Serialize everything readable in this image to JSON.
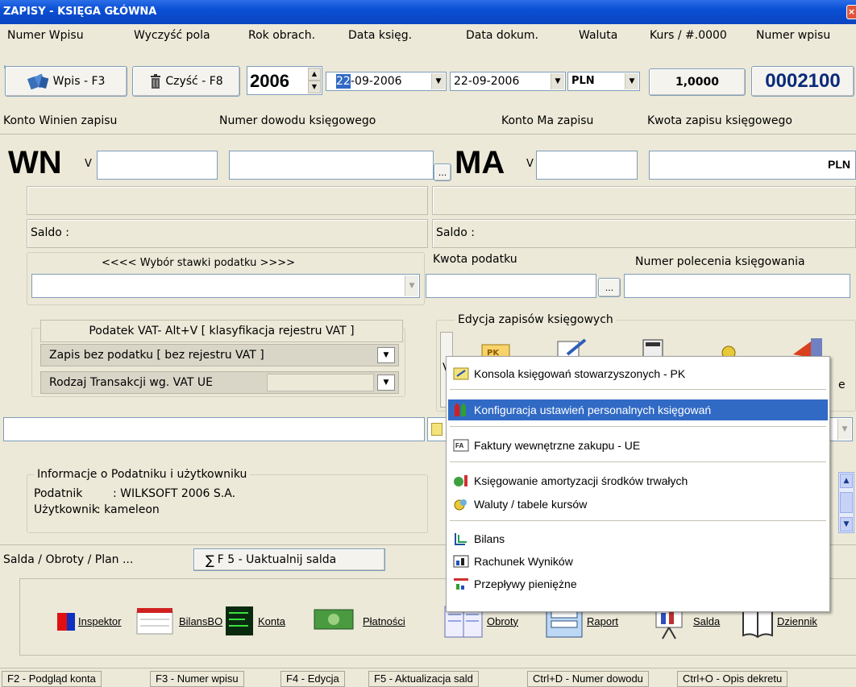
{
  "window": {
    "title": "ZAPISY - KSIĘGA GŁÓWNA",
    "close_glyph": "×"
  },
  "header_labels": {
    "numer_wpisu": "Numer Wpisu",
    "wyczysc_pola": "Wyczyść pola",
    "rok_obrach": "Rok obrach.",
    "data_ksieg": "Data księg.",
    "data_dokum": "Data dokum.",
    "waluta": "Waluta",
    "kurs": "Kurs  / #.0000",
    "numer_wpisu2": "Numer wpisu"
  },
  "toolbar": {
    "wpis_label": "Wpis - F3",
    "czysc_label": "Czyść - F8",
    "rok": "2006",
    "data_ksieg_day": "22",
    "data_ksieg_rest": "-09-2006",
    "data_dokum": "22-09-2006",
    "waluta": "PLN",
    "kurs": "1,0000",
    "numer_wpisu": "0002100"
  },
  "labels_row2": {
    "konto_winien": "Konto  Winien  zapisu",
    "numer_dowodu": "Numer dowodu księgowego",
    "konto_ma": "Konto   Ma   zapisu",
    "kwota_zapisu": "Kwota zapisu księgowego"
  },
  "entry": {
    "wn": "WN",
    "ma": "MA",
    "v": "V",
    "ellipsis": "...",
    "currency": "PLN"
  },
  "saldo": {
    "left": "Saldo :",
    "right": "Saldo :"
  },
  "tax": {
    "wybor_stawki": "<<<<  Wybór stawki podatku  >>>>",
    "kwota_podatku": "Kwota podatku",
    "numer_polecenia": "Numer polecenia księgowania"
  },
  "vat_group": {
    "title": "Podatek VAT- Alt+V [ klasyfikacja rejestru VAT ]",
    "zapis": "Zapis bez podatku [ bez rejestru VAT ]",
    "rodzaj": "Rodzaj Transakcji wg. VAT UE"
  },
  "edycja_group": {
    "title": "Edycja zapisów księgowych"
  },
  "info_group": {
    "title": "Informacje o Podatniku i użytkowniku",
    "podatnik_label": "Podatnik",
    "podatnik_value": ": WILKSOFT 2006  S.A.",
    "uzytkownik_label": "Użytkownik",
    "uzytkownik_value": ": kameleon"
  },
  "tabs": {
    "salda": "Salda / Obroty / Plan ...",
    "uaktualnij": "F 5 -  Uaktualnij salda",
    "sigma": "∑"
  },
  "tools": [
    {
      "label": "Inspektor",
      "icon": "inspector-icon"
    },
    {
      "label": "BilansBO",
      "icon": "bilansbo-icon"
    },
    {
      "label": "Konta",
      "icon": "konta-icon"
    },
    {
      "label": "Płatności",
      "icon": "platnosci-icon"
    },
    {
      "label": "Obroty",
      "icon": "obroty-icon"
    },
    {
      "label": "Raport",
      "icon": "raport-icon"
    },
    {
      "label": "Salda",
      "icon": "salda-icon"
    },
    {
      "label": "Dziennik",
      "icon": "dziennik-icon"
    }
  ],
  "menu": {
    "items": [
      {
        "label": "Konsola księgowań stowarzyszonych - PK",
        "icon": "pk-console-icon",
        "selected": false
      },
      {
        "label": "Konfiguracja ustawień personalnych księgowań",
        "icon": "config-icon",
        "selected": true
      },
      {
        "label": "Faktury wewnętrzne zakupu - UE",
        "icon": "invoice-icon",
        "selected": false
      },
      {
        "label": "Księgowanie amortyzacji środków trwałych",
        "icon": "depreciation-icon",
        "selected": false
      },
      {
        "label": "Waluty / tabele kursów",
        "icon": "currency-icon",
        "selected": false
      },
      {
        "label": "Bilans",
        "icon": "balance-icon",
        "selected": false
      },
      {
        "label": "Rachunek Wyników",
        "icon": "income-icon",
        "selected": false
      },
      {
        "label": "Przepływy pieniężne",
        "icon": "cashflow-icon",
        "selected": false
      }
    ]
  },
  "partial": {
    "lett_v": "V",
    "lett_e": "e",
    "pk_text": "PK"
  },
  "statusbar": [
    "F2 - Podgląd konta",
    "F3 - Numer wpisu",
    "F4 - Edycja",
    "F5 - Aktualizacja sald",
    "Ctrl+D - Numer dowodu",
    "Ctrl+O - Opis dekretu"
  ]
}
